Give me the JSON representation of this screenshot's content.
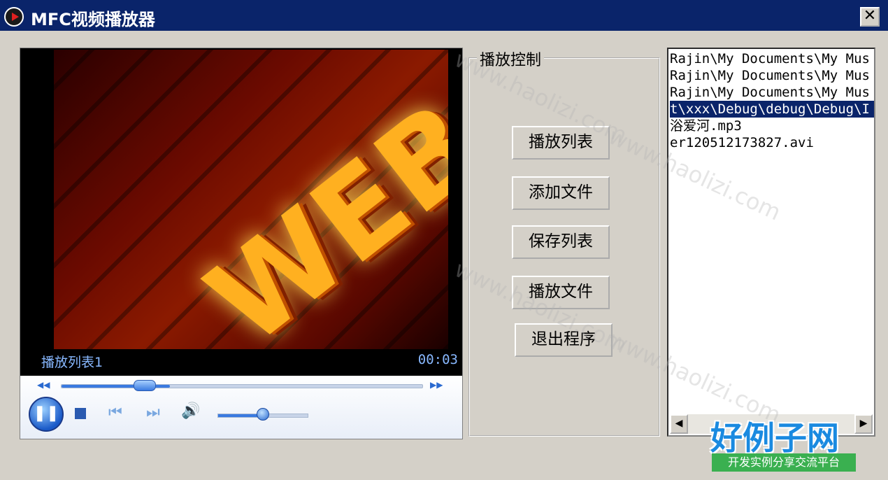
{
  "window": {
    "title": "MFC视频播放器",
    "close_symbol": "✕"
  },
  "player": {
    "media_title": "播放列表1",
    "time": "00:03",
    "video_text": "WEB",
    "seek_progress": 0.3,
    "volume_level": 0.5,
    "icons": {
      "seek_back": "◀◀",
      "seek_forward": "▶▶",
      "pause": "❚❚",
      "prev": "⏮",
      "next": "⏭",
      "volume": "🔊"
    }
  },
  "controls_group": {
    "label": "播放控制",
    "buttons": {
      "playlist": "播放列表",
      "add_file": "添加文件",
      "save_list": "保存列表",
      "play_file": "播放文件",
      "exit": "退出程序"
    }
  },
  "playlist": {
    "items": [
      "Rajin\\My Documents\\My Mus",
      "Rajin\\My Documents\\My Mus",
      "Rajin\\My Documents\\My Mus",
      "t\\xxx\\Debug\\debug\\Debug\\I",
      "浴爱河.mp3",
      "er120512173827.avi"
    ],
    "selected_index": 3,
    "scroll_left": "◀",
    "scroll_right": "▶"
  },
  "watermark": {
    "main": "好例子网",
    "sub": "开发实例分享交流平台",
    "diagonal": "www.haolizi.com"
  },
  "colors": {
    "titlebar": "#0a246a",
    "face": "#d4d0c8",
    "selection": "#0a246a"
  }
}
